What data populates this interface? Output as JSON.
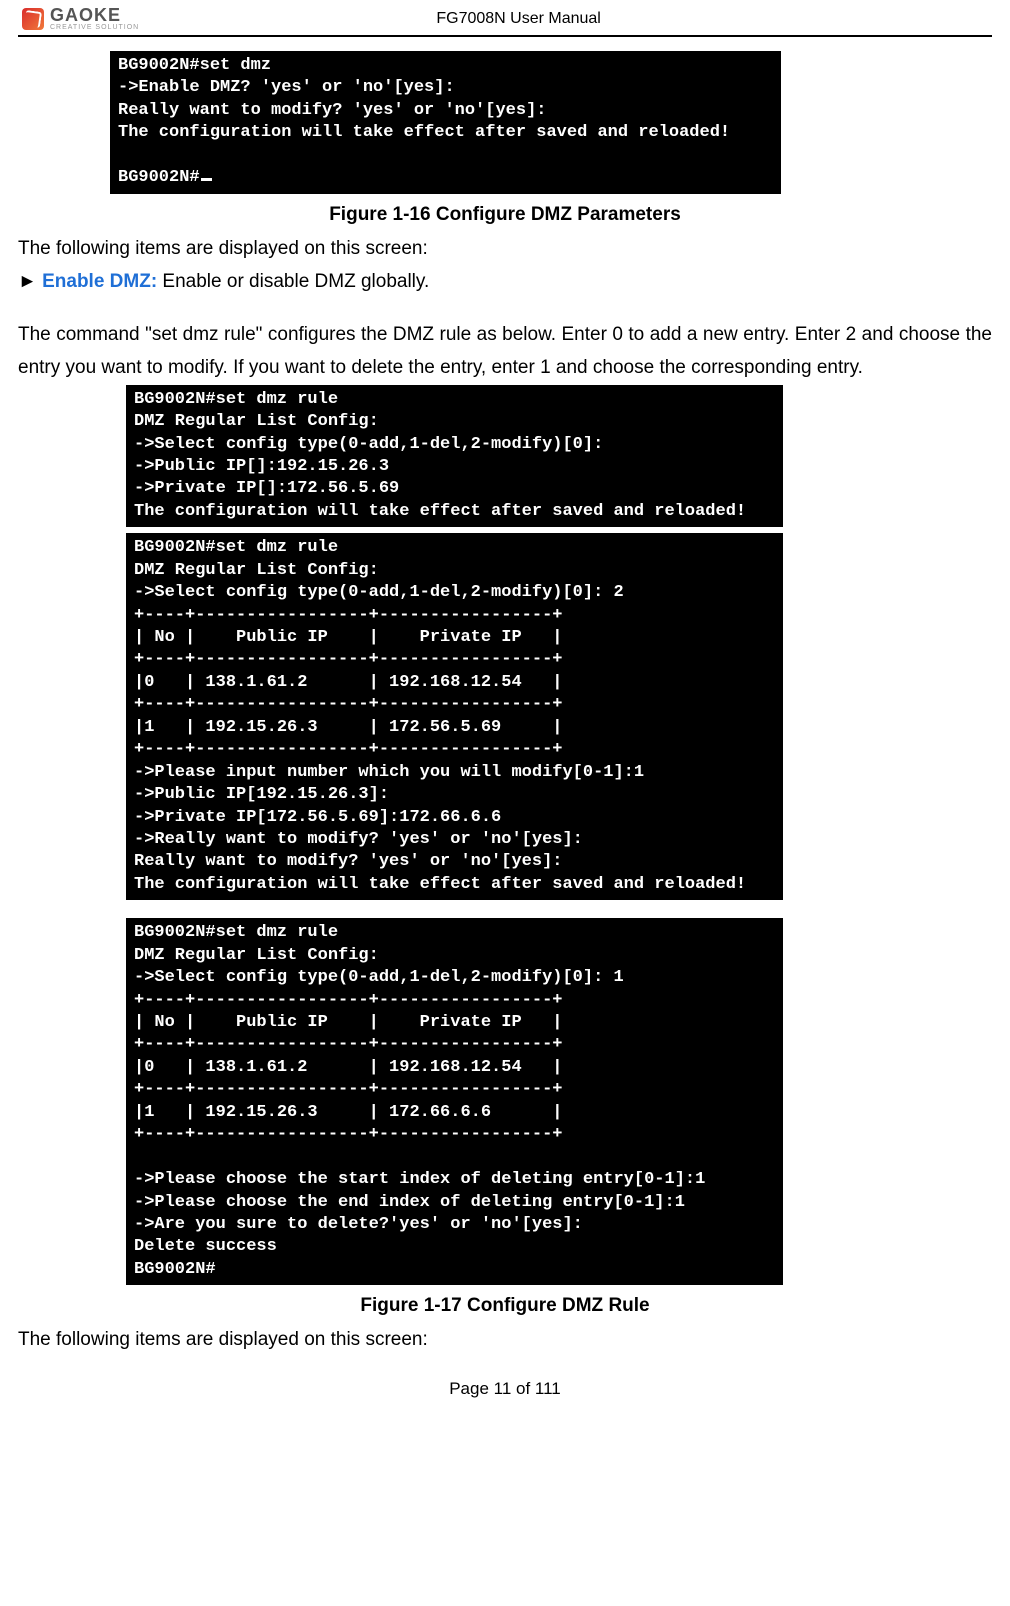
{
  "header": {
    "logo_name": "GAOKE",
    "logo_sub": "CREATIVE SOLUTION",
    "doc_title": "FG7008N User Manual"
  },
  "terminal1": {
    "text": "BG9002N#set dmz\n->Enable DMZ? 'yes' or 'no'[yes]:\nReally want to modify? 'yes' or 'no'[yes]:\nThe configuration will take effect after saved and reloaded!\n\nBG9002N#"
  },
  "caption1": "Figure 1-16    Configure DMZ Parameters",
  "para1": "The following items are displayed on this screen:",
  "enable_prefix": "► ",
  "enable_label": "Enable DMZ:",
  "enable_desc": " Enable or disable DMZ globally.",
  "para2": "The command \"set dmz rule\" configures the DMZ rule as below. Enter 0 to add a new entry. Enter 2 and choose the entry you want to modify. If you want to delete the entry, enter 1 and choose the corresponding entry.",
  "terminal2": {
    "text": "BG9002N#set dmz rule\nDMZ Regular List Config:\n->Select config type(0-add,1-del,2-modify)[0]:\n->Public IP[]:192.15.26.3\n->Private IP[]:172.56.5.69\nThe configuration will take effect after saved and reloaded!"
  },
  "terminal3": {
    "text": "BG9002N#set dmz rule\nDMZ Regular List Config:\n->Select config type(0-add,1-del,2-modify)[0]: 2\n+----+-----------------+-----------------+\n| No |    Public IP    |    Private IP   |\n+----+-----------------+-----------------+\n|0   | 138.1.61.2      | 192.168.12.54   |\n+----+-----------------+-----------------+\n|1   | 192.15.26.3     | 172.56.5.69     |\n+----+-----------------+-----------------+\n->Please input number which you will modify[0-1]:1\n->Public IP[192.15.26.3]:\n->Private IP[172.56.5.69]:172.66.6.6\n->Really want to modify? 'yes' or 'no'[yes]:\nReally want to modify? 'yes' or 'no'[yes]:\nThe configuration will take effect after saved and reloaded!"
  },
  "terminal4": {
    "text": "BG9002N#set dmz rule\nDMZ Regular List Config:\n->Select config type(0-add,1-del,2-modify)[0]: 1\n+----+-----------------+-----------------+\n| No |    Public IP    |    Private IP   |\n+----+-----------------+-----------------+\n|0   | 138.1.61.2      | 192.168.12.54   |\n+----+-----------------+-----------------+\n|1   | 192.15.26.3     | 172.66.6.6      |\n+----+-----------------+-----------------+\n\n->Please choose the start index of deleting entry[0-1]:1\n->Please choose the end index of deleting entry[0-1]:1\n->Are you sure to delete?'yes' or 'no'[yes]:\nDelete success\nBG9002N#"
  },
  "caption2": "Figure 1-17    Configure DMZ Rule",
  "para3": "The following items are displayed on this screen:",
  "footer": "Page 11 of 111"
}
